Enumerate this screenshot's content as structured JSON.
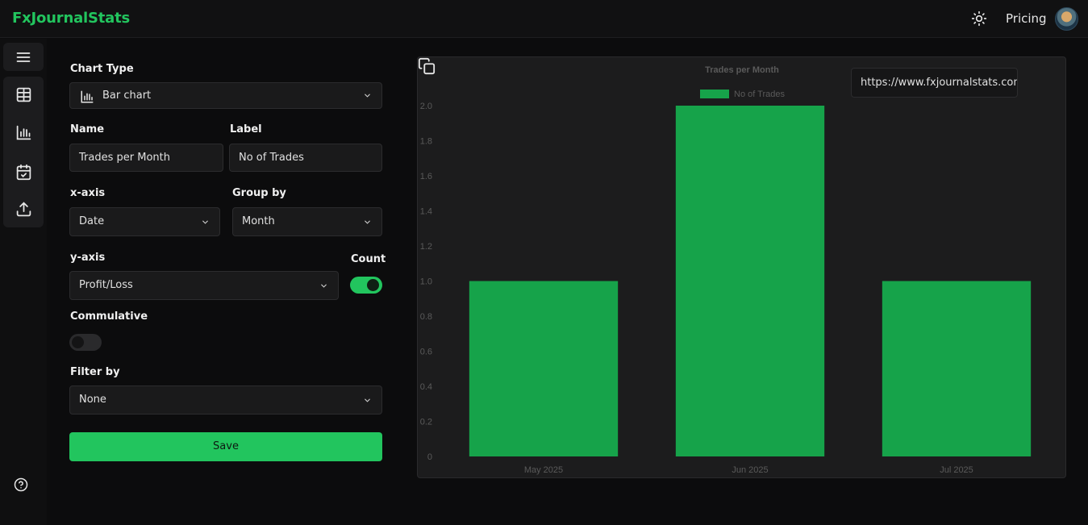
{
  "app": {
    "brand": "FxJournalStats",
    "pricing_label": "Pricing"
  },
  "icons": {
    "theme": "sun-icon",
    "menu": "menu-icon",
    "table": "table-icon",
    "chart": "bar-chart-icon",
    "calendar": "calendar-check-icon",
    "upload": "upload-icon",
    "help": "help-circle-icon",
    "copy": "copy-icon"
  },
  "form": {
    "chart_type": {
      "label": "Chart Type",
      "value": "Bar chart"
    },
    "name": {
      "label": "Name",
      "value": "Trades per Month"
    },
    "series_label": {
      "label": "Label",
      "value": "No of Trades"
    },
    "x_axis": {
      "label": "x-axis",
      "value": "Date"
    },
    "group_by": {
      "label": "Group by",
      "value": "Month"
    },
    "y_axis": {
      "label": "y-axis",
      "value": "Profit/Loss"
    },
    "count": {
      "label": "Count",
      "on": true
    },
    "cumulative": {
      "label": "Commulative",
      "on": false
    },
    "filter_by": {
      "label": "Filter by",
      "value": "None"
    },
    "save_label": "Save"
  },
  "share": {
    "url": "https://www.fxjournalstats.com"
  },
  "colors": {
    "accent": "#22c55e",
    "bar": "#16a34a"
  },
  "chart_data": {
    "type": "bar",
    "title": "Trades per Month",
    "categories": [
      "May 2025",
      "Jun 2025",
      "Jul 2025"
    ],
    "series": [
      {
        "name": "No of Trades",
        "values": [
          1,
          2,
          1
        ]
      }
    ],
    "ylim": [
      0,
      2
    ],
    "yticks": [
      "0",
      "0.2",
      "0.4",
      "0.6",
      "0.8",
      "1.0",
      "1.2",
      "1.4",
      "1.6",
      "1.8",
      "2.0"
    ],
    "legend": "top",
    "grid": false
  }
}
